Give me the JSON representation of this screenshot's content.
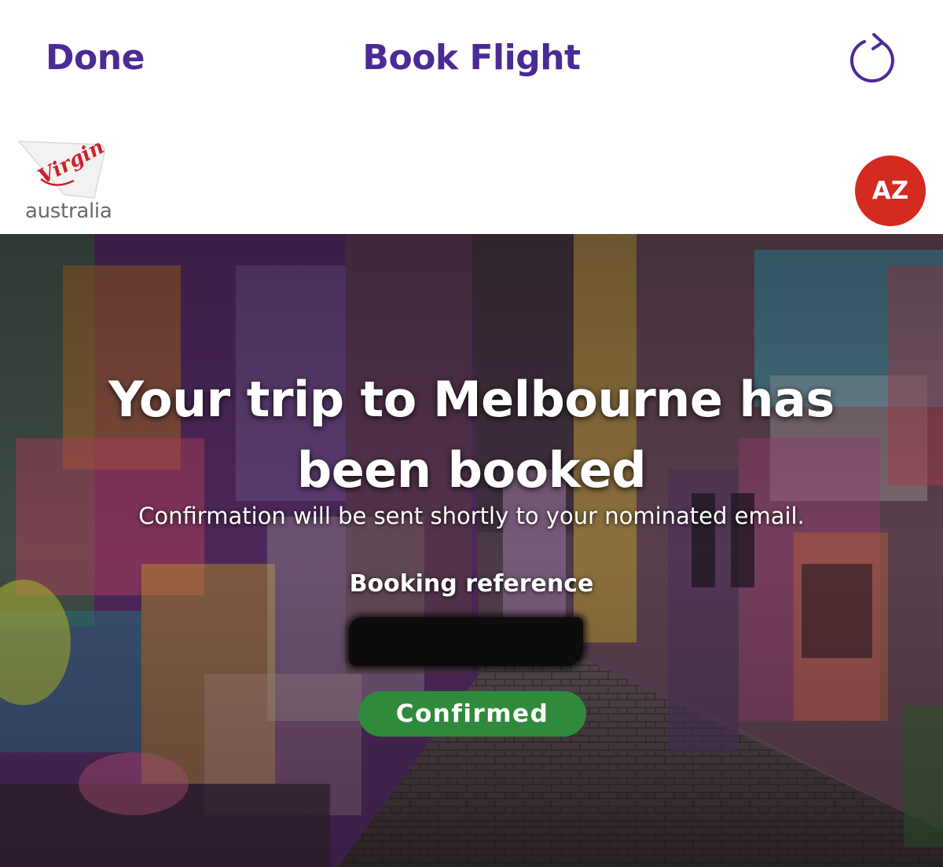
{
  "nav": {
    "done_label": "Done",
    "title": "Book Flight",
    "reload_icon": "reload-icon"
  },
  "brand": {
    "logo_script": "Virgin",
    "logo_word": "australia",
    "avatar_initials": "AZ"
  },
  "hero": {
    "title": "Your trip to Melbourne has been booked",
    "subtitle": "Confirmation will be sent shortly to your nominated email.",
    "reference_label": "Booking reference",
    "status": "Confirmed"
  },
  "colors": {
    "brand_purple": "#4b2a96",
    "brand_red": "#d42a20",
    "status_green": "#2f8a3c"
  }
}
